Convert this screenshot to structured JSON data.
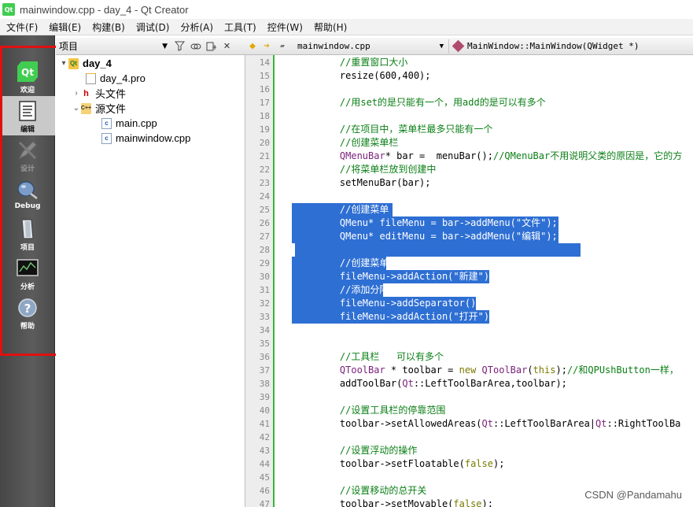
{
  "window": {
    "title": "mainwindow.cpp - day_4 - Qt Creator",
    "logo_text": "Qt"
  },
  "menubar": {
    "items": [
      "文件(F)",
      "编辑(E)",
      "构建(B)",
      "调试(D)",
      "分析(A)",
      "工具(T)",
      "控件(W)",
      "帮助(H)"
    ]
  },
  "modebar": {
    "items": [
      {
        "label": "欢迎",
        "icon": "qt-logo-icon"
      },
      {
        "label": "编辑",
        "icon": "edit-document-icon"
      },
      {
        "label": "设计",
        "icon": "design-pen-icon"
      },
      {
        "label": "Debug",
        "icon": "debug-bug-icon"
      },
      {
        "label": "项目",
        "icon": "project-wrench-icon"
      },
      {
        "label": "分析",
        "icon": "analyze-monitor-icon"
      },
      {
        "label": "帮助",
        "icon": "help-question-icon"
      }
    ],
    "active_index": 1,
    "highlight_color": "#e01010"
  },
  "project_pane": {
    "selector_label": "项目",
    "tree": [
      {
        "label": "day_4",
        "bold": true
      },
      {
        "label": "day_4.pro"
      },
      {
        "label": "头文件"
      },
      {
        "label": "源文件"
      },
      {
        "label": "main.cpp"
      },
      {
        "label": "mainwindow.cpp"
      }
    ]
  },
  "editor": {
    "file_name": "mainwindow.cpp",
    "symbol": "MainWindow::MainWindow(QWidget *)",
    "selection_color": "#2e6fd3",
    "lines": [
      {
        "n": "14",
        "text": "    //重置窗口大小"
      },
      {
        "n": "15",
        "text": "    resize(600,400);"
      },
      {
        "n": "16",
        "text": ""
      },
      {
        "n": "17",
        "text": "    //用set的是只能有一个，用add的是可以有多个"
      },
      {
        "n": "18",
        "text": ""
      },
      {
        "n": "19",
        "text": "    //在项目中，菜单栏最多只能有一个"
      },
      {
        "n": "20",
        "text": "    //创建菜单栏"
      },
      {
        "n": "21",
        "text": "    QMenuBar* bar =  menuBar();//QMenuBar不用说明父类的原因是，它的方"
      },
      {
        "n": "22",
        "text": "    //将菜单栏放到创建中"
      },
      {
        "n": "23",
        "text": "    setMenuBar(bar);"
      },
      {
        "n": "24",
        "text": ""
      },
      {
        "n": "25",
        "text": "    //创建菜单"
      },
      {
        "n": "26",
        "text": "    QMenu* fileMenu = bar->addMenu(\"文件\");"
      },
      {
        "n": "27",
        "text": "    QMenu* editMenu = bar->addMenu(\"编辑\");"
      },
      {
        "n": "28",
        "text": ""
      },
      {
        "n": "29",
        "text": "    //创建菜单项"
      },
      {
        "n": "30",
        "text": "    fileMenu->addAction(\"新建\");"
      },
      {
        "n": "31",
        "text": "    //添加分隔符"
      },
      {
        "n": "32",
        "text": "    fileMenu->addSeparator();"
      },
      {
        "n": "33",
        "text": "    fileMenu->addAction(\"打开\");"
      },
      {
        "n": "34",
        "text": ""
      },
      {
        "n": "35",
        "text": ""
      },
      {
        "n": "36",
        "text": "    //工具栏   可以有多个"
      },
      {
        "n": "37",
        "text": "    QToolBar * toolbar = new QToolBar(this);//和QPUshButton一样，"
      },
      {
        "n": "38",
        "text": "    addToolBar(Qt::LeftToolBarArea,toolbar);"
      },
      {
        "n": "39",
        "text": ""
      },
      {
        "n": "40",
        "text": "    //设置工具栏的停靠范围"
      },
      {
        "n": "41",
        "text": "    toolbar->setAllowedAreas(Qt::LeftToolBarArea|Qt::RightToolBa"
      },
      {
        "n": "42",
        "text": ""
      },
      {
        "n": "43",
        "text": "    //设置浮动的操作"
      },
      {
        "n": "44",
        "text": "    toolbar->setFloatable(false);"
      },
      {
        "n": "45",
        "text": ""
      },
      {
        "n": "46",
        "text": "    //设置移动的总开关"
      },
      {
        "n": "47",
        "text": "    toolbar->setMovable(false);"
      }
    ]
  },
  "watermark": "CSDN @Pandamahu"
}
